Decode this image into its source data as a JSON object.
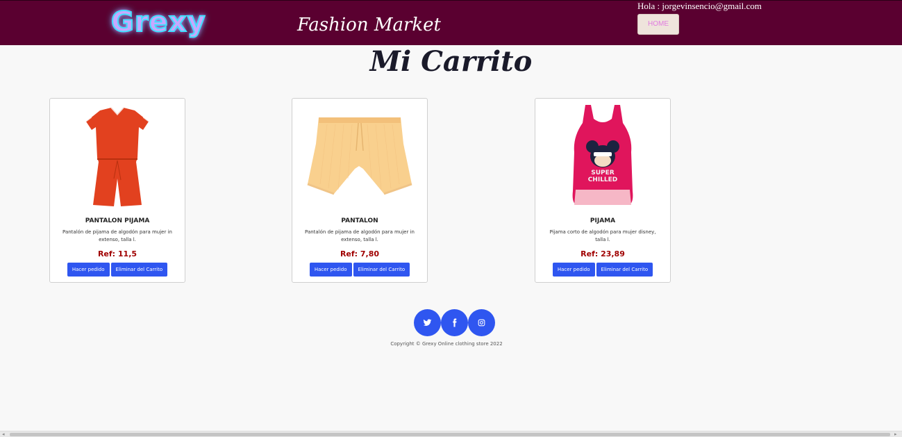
{
  "header": {
    "logo": "Grexy",
    "brand": "Fashion Market",
    "greeting": "Hola : jorgevinsencio@gmail.com",
    "home_label": "HOME"
  },
  "page_title": "Mi Carrito",
  "products": [
    {
      "name": "PANTALON PIJAMA",
      "description": "Pantalón de pijama de algodón para mujer in extenso, talla l.",
      "price": "Ref: 11,5",
      "order_label": "Hacer pedido",
      "remove_label": "Eliminar del Carrito"
    },
    {
      "name": "PANTALON",
      "description": "Pantalón de pijama de algodón para mujer in extenso, talla l.",
      "price": "Ref: 7,80",
      "order_label": "Hacer pedido",
      "remove_label": "Eliminar del Carrito"
    },
    {
      "name": "PIJAMA",
      "description": "Pijama corto de algodón para mujer disney, talla l.",
      "price": "Ref: 23,89",
      "order_label": "Hacer pedido",
      "remove_label": "Eliminar del Carrito"
    }
  ],
  "social": {
    "icons": [
      "twitter-icon",
      "facebook-icon",
      "instagram-icon"
    ]
  },
  "footer": {
    "copyright": "Copyright © Grexy Online clothing store 2022"
  },
  "colors": {
    "header_bg": "#5a0030",
    "button_blue": "#2f56f0",
    "price_red": "#a00000"
  }
}
